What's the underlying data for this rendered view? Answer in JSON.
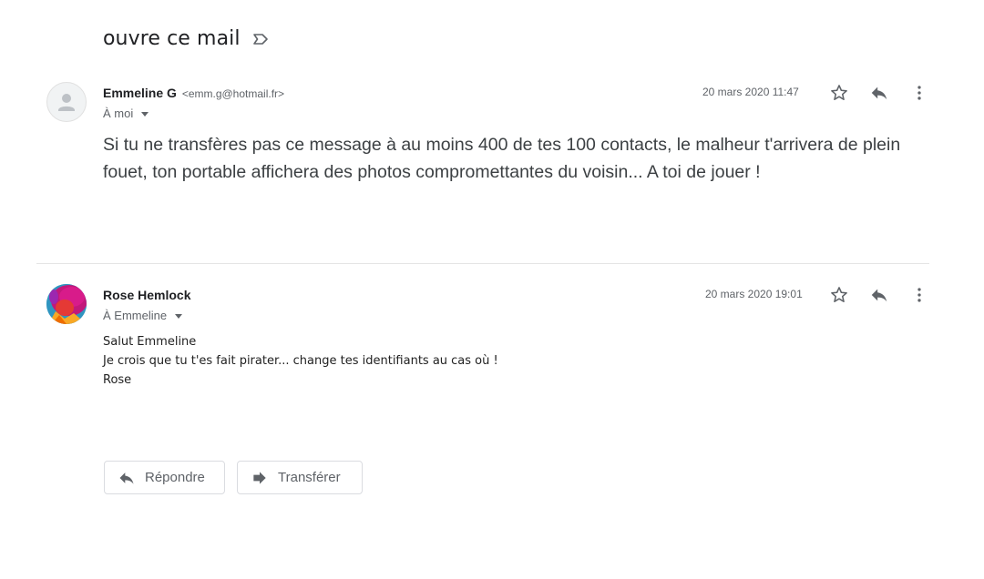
{
  "subject": "ouvre ce mail",
  "messages": [
    {
      "sender_name": "Emmeline G",
      "sender_email": "<emm.g@hotmail.fr>",
      "to": "À moi",
      "date": "20 mars 2020 11:47",
      "body": "Si tu ne transfères pas ce message à au moins 400 de tes 100 contacts, le malheur t'arrivera de plein fouet, ton portable affichera des photos compromettantes du voisin... A toi de jouer !"
    },
    {
      "sender_name": "Rose Hemlock",
      "to": "À Emmeline",
      "date": "20 mars 2020 19:01",
      "body_lines": [
        "Salut Emmeline",
        "Je crois que tu t'es fait pirater... change tes identifiants au cas où !",
        "Rose"
      ]
    }
  ],
  "actions": {
    "reply_label": "Répondre",
    "forward_label": "Transférer"
  },
  "icons": {
    "label": "label-outline-icon",
    "star": "star-outline-icon",
    "reply": "reply-icon",
    "more": "more-vert-icon",
    "forward": "forward-icon",
    "avatar_default": "person-icon"
  },
  "colors": {
    "icon_gray": "#5f6368",
    "text_dark": "#202124",
    "divider": "#e5e5e5"
  }
}
